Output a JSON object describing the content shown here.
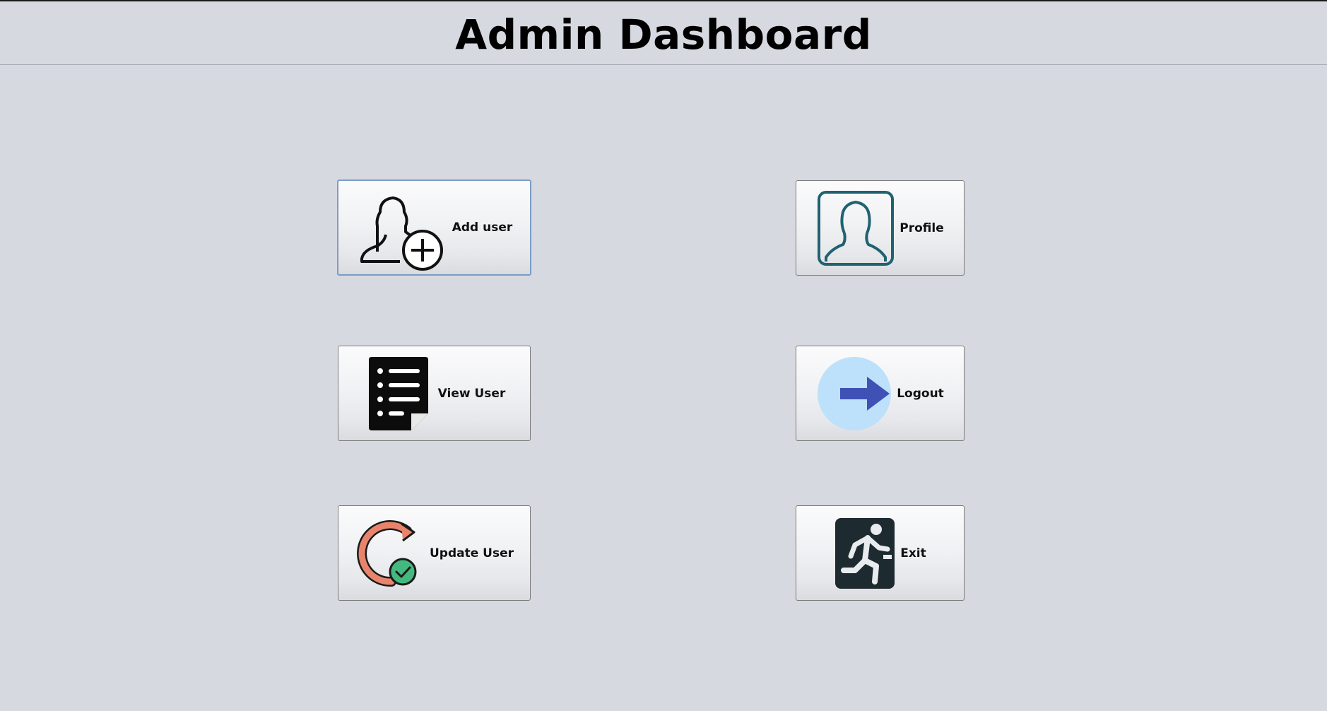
{
  "header": {
    "title": "Admin Dashboard"
  },
  "buttons": {
    "add_user": {
      "label": "Add user",
      "icon": "add-user-icon"
    },
    "view_user": {
      "label": "View User",
      "icon": "document-list-icon"
    },
    "update_user": {
      "label": "Update User",
      "icon": "refresh-check-icon"
    },
    "profile": {
      "label": "Profile",
      "icon": "profile-icon"
    },
    "logout": {
      "label": "Logout",
      "icon": "logout-arrow-icon"
    },
    "exit": {
      "label": "Exit",
      "icon": "exit-running-icon"
    }
  },
  "colors": {
    "background": "#d6d9e0",
    "profile_icon": "#1f6272",
    "logout_circle": "#bde0fb",
    "logout_arrow": "#3f51b5",
    "update_ring": "#e9846b",
    "update_check": "#43b97f",
    "exit_tile": "#1d2a30"
  }
}
